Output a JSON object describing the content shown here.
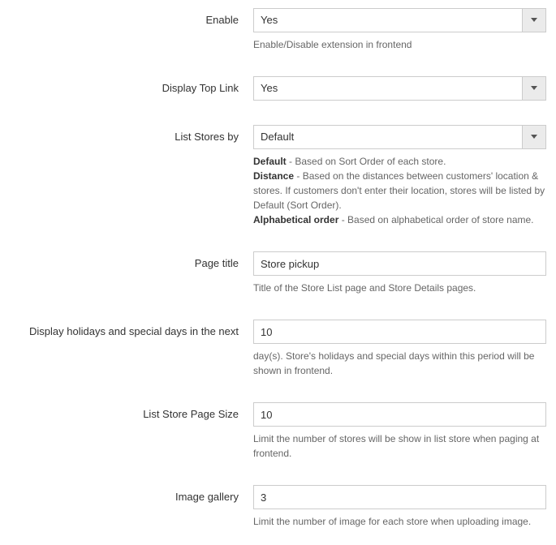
{
  "fields": {
    "enable": {
      "label": "Enable",
      "value": "Yes",
      "help": "Enable/Disable extension in frontend"
    },
    "display_top_link": {
      "label": "Display Top Link",
      "value": "Yes"
    },
    "list_stores_by": {
      "label": "List Stores by",
      "value": "Default",
      "help_parts": {
        "default_b": "Default",
        "default_t": " - Based on Sort Order of each store.",
        "distance_b": "Distance",
        "distance_t": " - Based on the distances between customers' location & stores. If customers don't enter their location, stores will be listed by Default (Sort Order).",
        "alpha_b": "Alphabetical order",
        "alpha_t": " - Based on alphabetical order of store name."
      }
    },
    "page_title": {
      "label": "Page title",
      "value": "Store pickup",
      "help": "Title of the Store List page and Store Details pages."
    },
    "display_holidays": {
      "label": "Display holidays and special days in the next",
      "value": "10",
      "help": "day(s). Store's holidays and special days within this period will be shown in frontend."
    },
    "list_page_size": {
      "label": "List Store Page Size",
      "value": "10",
      "help": "Limit the number of stores will be show in list store when paging at frontend."
    },
    "image_gallery": {
      "label": "Image gallery",
      "value": "3",
      "help": "Limit the number of image for each store when uploading image."
    }
  }
}
